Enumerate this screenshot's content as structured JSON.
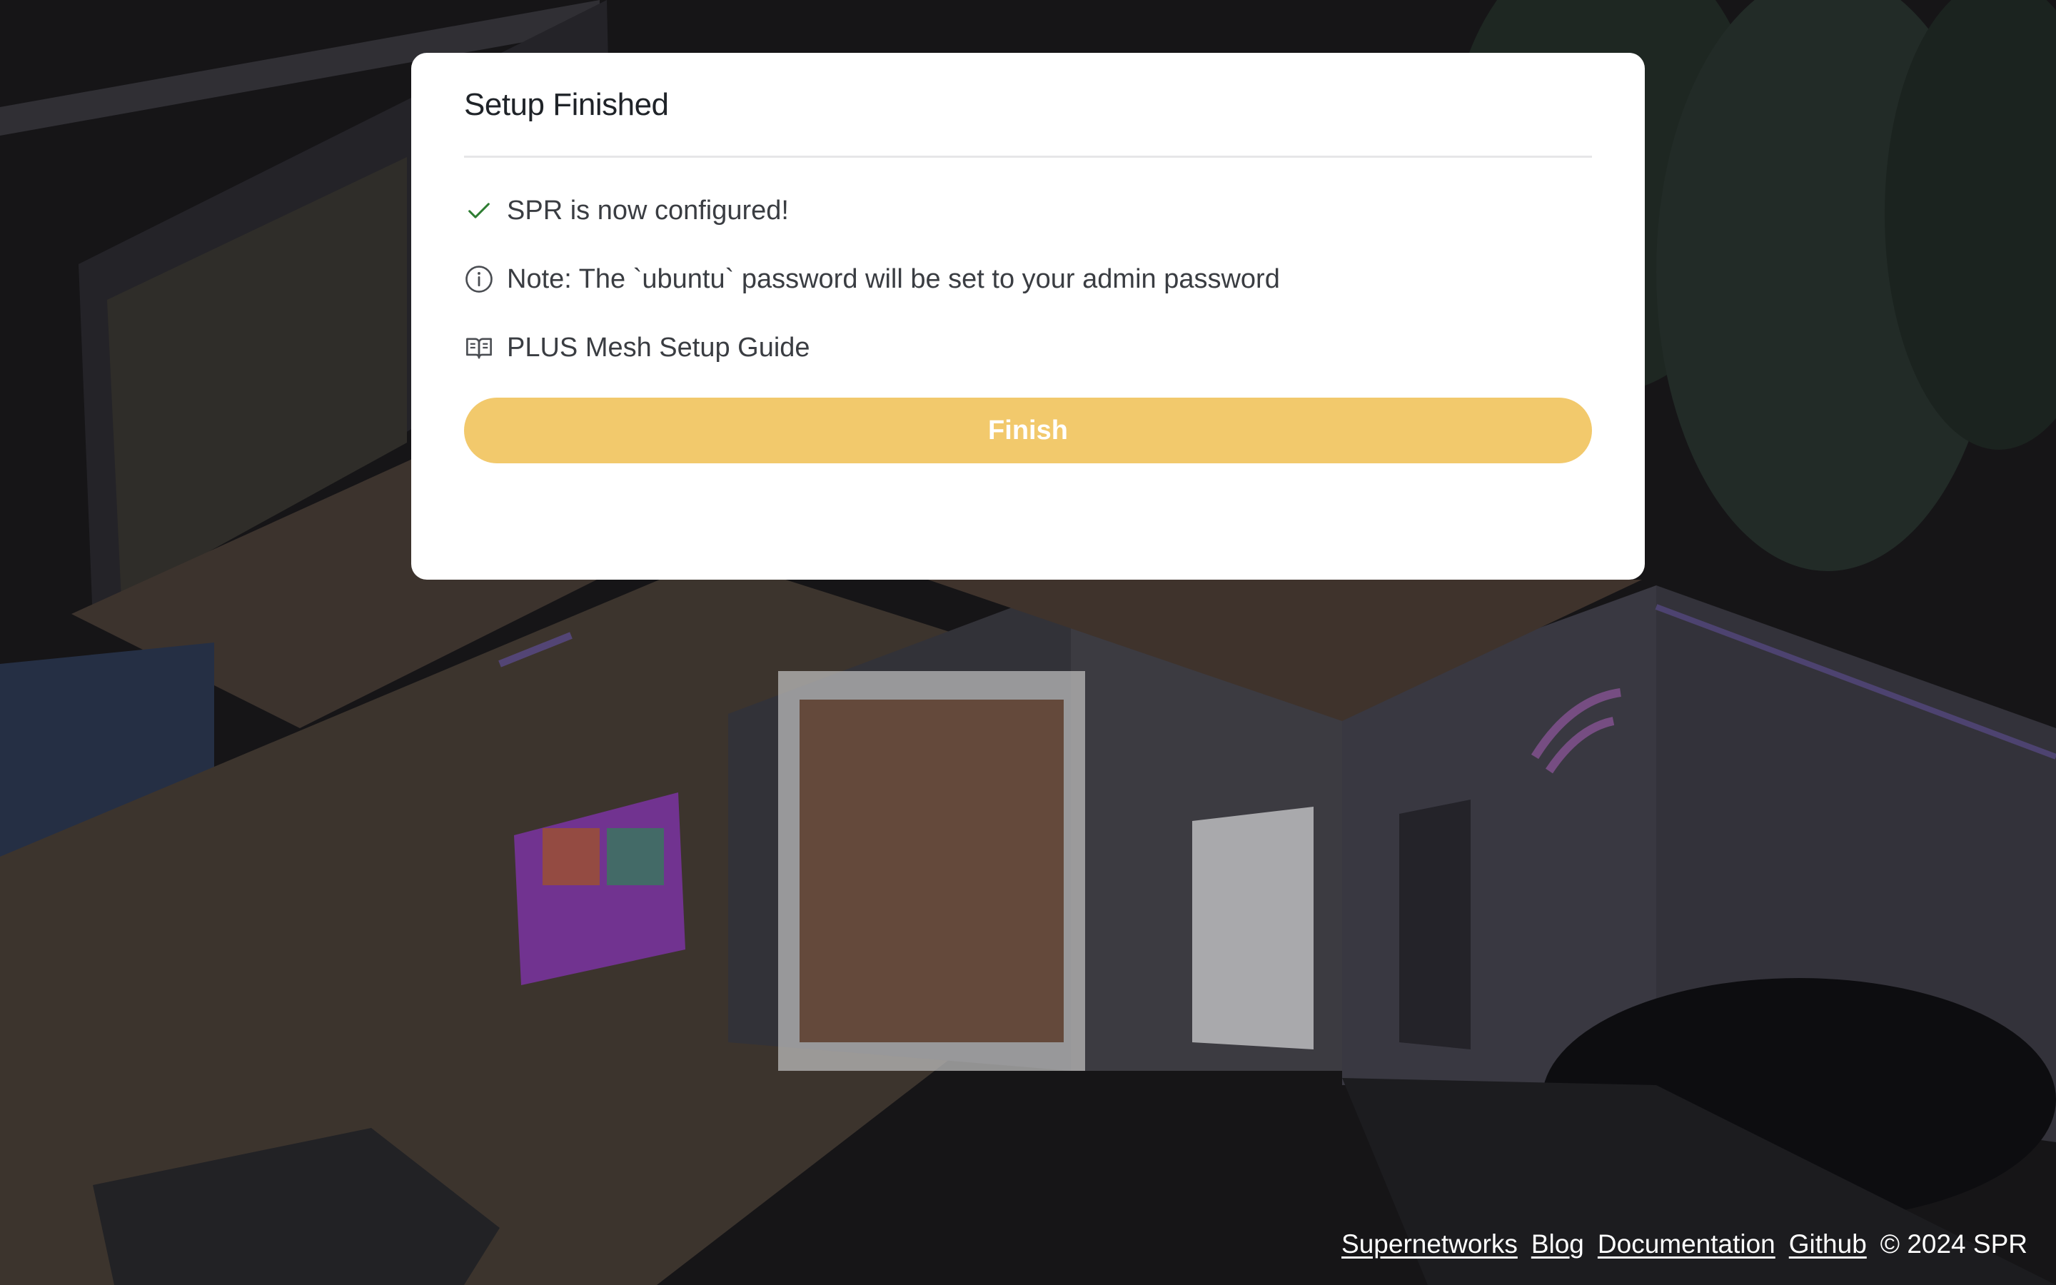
{
  "dialog": {
    "title": "Setup Finished",
    "items": [
      {
        "icon": "check-icon",
        "text": "SPR is now configured!"
      },
      {
        "icon": "info-icon",
        "text": "Note: The `ubuntu` password will be set to your admin password"
      },
      {
        "icon": "book-open-icon",
        "text": "PLUS Mesh Setup Guide"
      }
    ],
    "finish_label": "Finish"
  },
  "footer": {
    "links": [
      "Supernetworks",
      "Blog",
      "Documentation",
      "Github"
    ],
    "copyright": "© 2024 SPR"
  },
  "colors": {
    "accent": "#f2c96c",
    "check": "#2e7d32",
    "background": "#1b1a1d"
  }
}
